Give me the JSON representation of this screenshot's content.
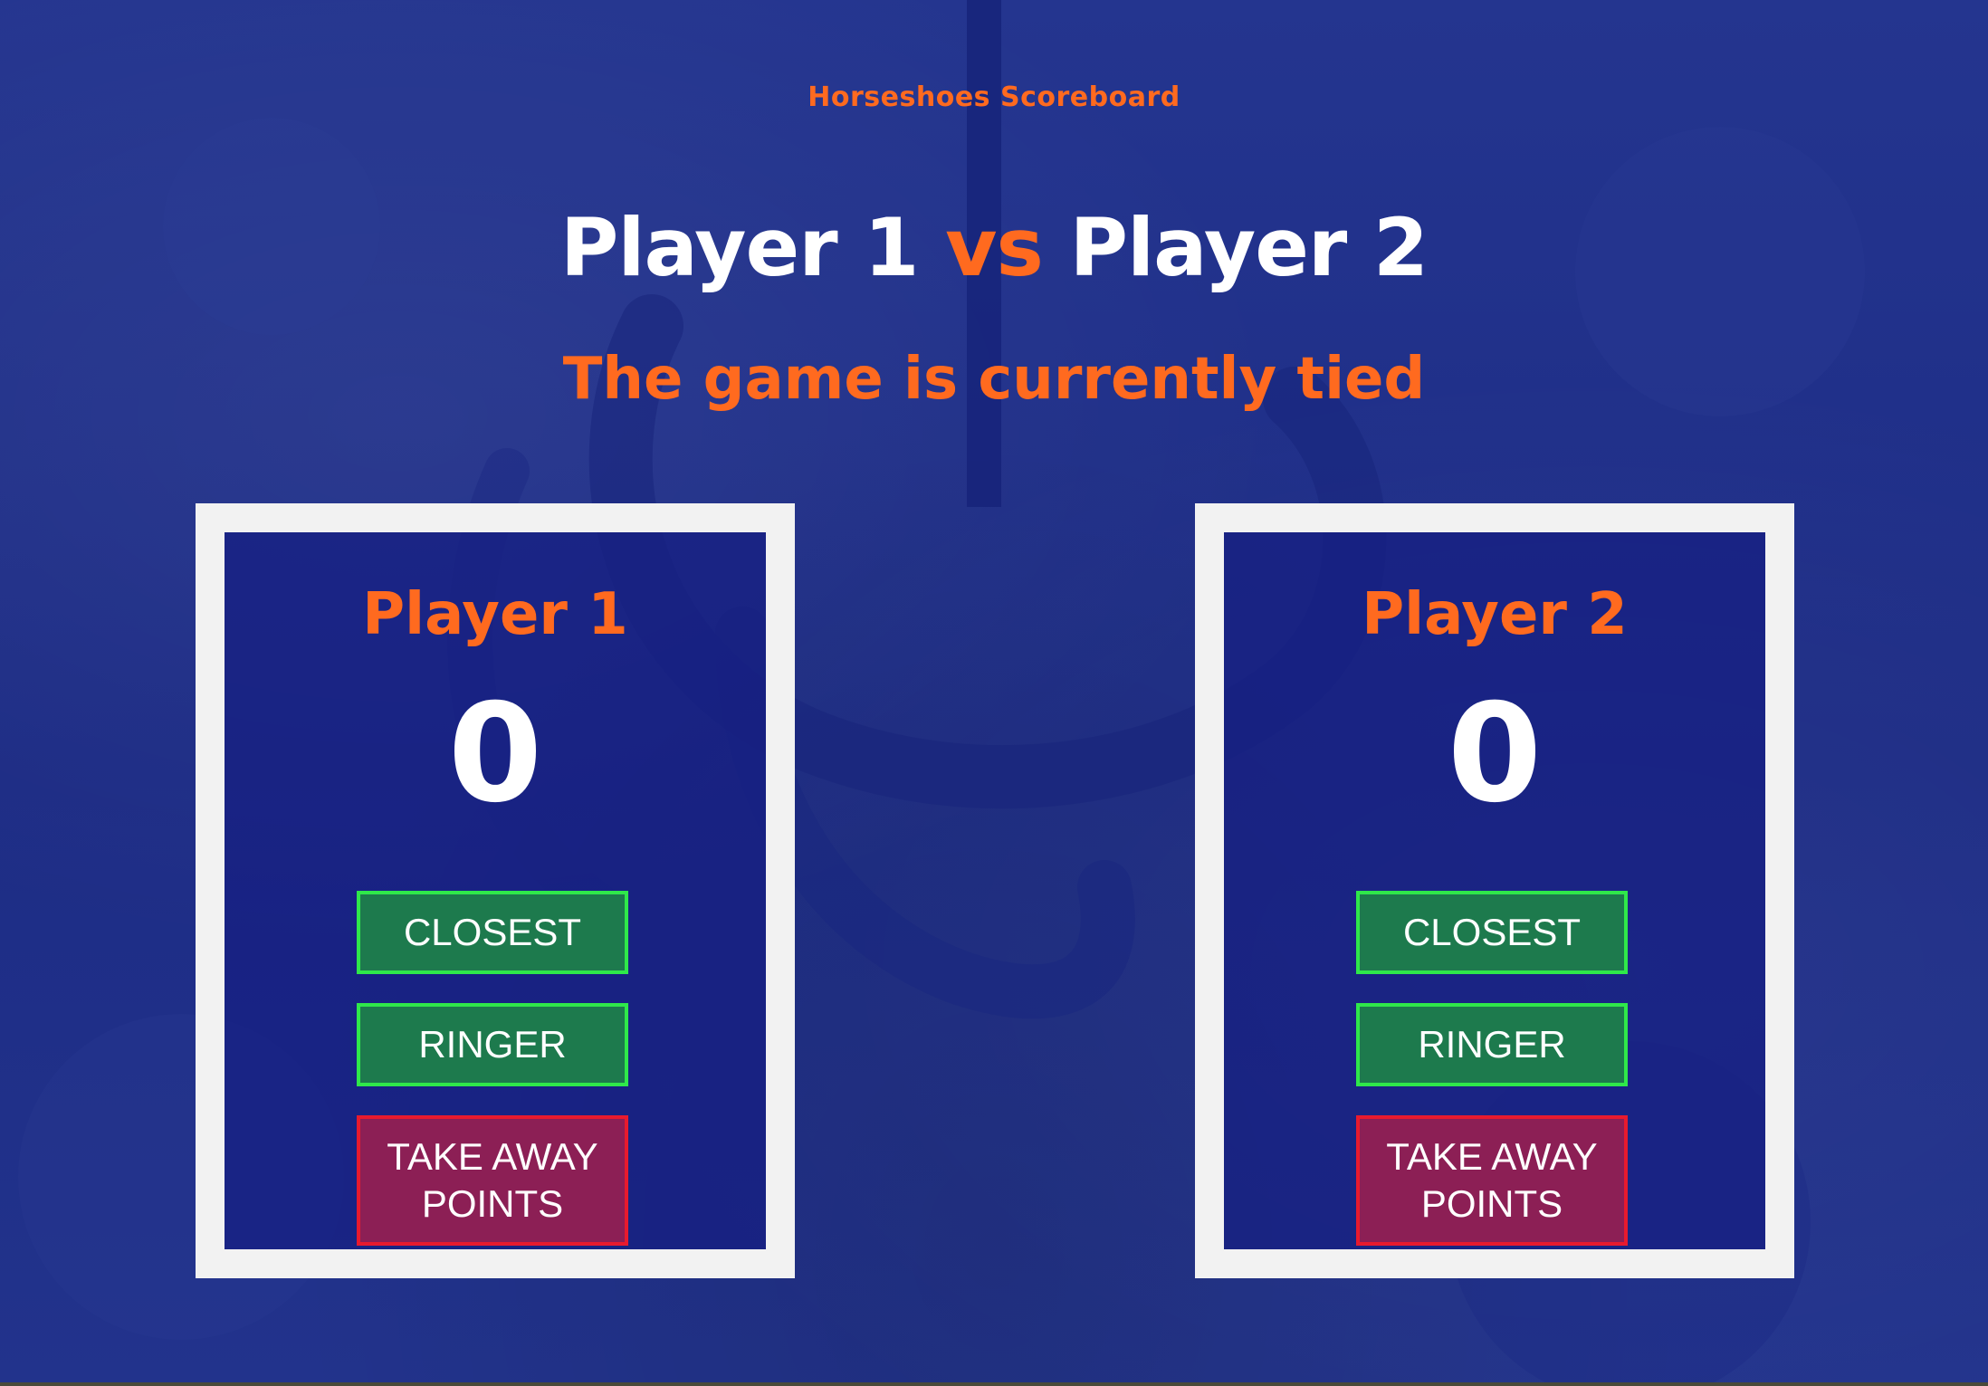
{
  "app": {
    "title": "Horseshoes Scoreboard"
  },
  "header": {
    "player1": "Player 1",
    "vs": "vs",
    "player2": "Player 2",
    "status": "The game is currently tied"
  },
  "players": [
    {
      "name": "Player 1",
      "score": "0",
      "buttons": {
        "closest": "CLOSEST",
        "ringer": "RINGER",
        "take_away": "TAKE AWAY POINTS"
      }
    },
    {
      "name": "Player 2",
      "score": "0",
      "buttons": {
        "closest": "CLOSEST",
        "ringer": "RINGER",
        "take_away": "TAKE AWAY POINTS"
      }
    }
  ],
  "colors": {
    "background": "#1f2f86",
    "accent": "#ff6a1f",
    "card_border": "#f2f2f2",
    "button_green_border": "#2fe84a",
    "button_green_fill": "#1d7a4d",
    "button_red_border": "#e81a2e",
    "button_red_fill": "#8c1f55"
  }
}
